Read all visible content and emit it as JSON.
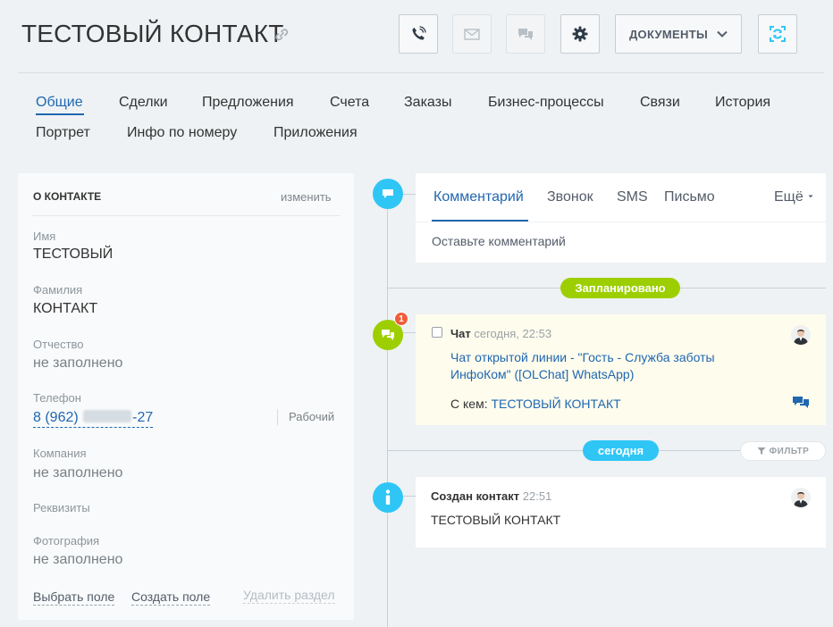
{
  "header": {
    "title": "ТЕСТОВЫЙ КОНТАКТ",
    "documents_label": "ДОКУМЕНТЫ",
    "icons": [
      "link-icon",
      "phone-icon",
      "mail-icon",
      "chat-icon",
      "gear-icon",
      "chevron-down-icon",
      "sync-icon"
    ]
  },
  "tabs": [
    {
      "label": "Общие",
      "active": true
    },
    {
      "label": "Сделки"
    },
    {
      "label": "Предложения"
    },
    {
      "label": "Счета"
    },
    {
      "label": "Заказы"
    },
    {
      "label": "Бизнес-процессы"
    },
    {
      "label": "Связи"
    },
    {
      "label": "История"
    },
    {
      "label": "Портрет"
    },
    {
      "label": "Инфо по номеру"
    },
    {
      "label": "Приложения"
    }
  ],
  "contact_card": {
    "section_title": "О КОНТАКТЕ",
    "edit_label": "изменить",
    "fields": {
      "first_name": {
        "label": "Имя",
        "value": "ТЕСТОВЫЙ"
      },
      "last_name": {
        "label": "Фамилия",
        "value": "КОНТАКТ"
      },
      "middle_name": {
        "label": "Отчество",
        "value": "не заполнено"
      },
      "phone": {
        "label": "Телефон",
        "prefix": "8 (962)",
        "suffix": "-27",
        "type": "Рабочий"
      },
      "company": {
        "label": "Компания",
        "value": "не заполнено"
      },
      "requisites": {
        "label": "Реквизиты"
      },
      "photo": {
        "label": "Фотография",
        "value": "не заполнено"
      }
    },
    "actions": {
      "select_field": "Выбрать поле",
      "create_field": "Создать поле",
      "delete_section": "Удалить раздел"
    }
  },
  "editor": {
    "tabs": [
      "Комментарий",
      "Звонок",
      "SMS",
      "Письмо"
    ],
    "more_label": "Ещё",
    "placeholder": "Оставьте комментарий"
  },
  "timeline": {
    "planned_label": "Запланировано",
    "today_label": "сегодня",
    "filter_label": "ФИЛЬТР",
    "chat_item": {
      "title": "Чат",
      "time": "сегодня, 22:53",
      "badge_count": "1",
      "link_text": "Чат открытой линии - \"Гость - Служба заботы ИнфоКом\" ([OLChat] WhatsApp)",
      "with_label": "С кем:",
      "with_value": "ТЕСТОВЫЙ КОНТАКТ"
    },
    "created_item": {
      "title": "Создан контакт",
      "time": "22:51",
      "value": "ТЕСТОВЫЙ КОНТАКТ"
    }
  },
  "colors": {
    "accent_blue": "#2067b0",
    "timeline_cyan": "#2fc6f6",
    "timeline_green": "#9dcf00",
    "badge_red": "#f05d3c",
    "background": "#eef2f4"
  }
}
